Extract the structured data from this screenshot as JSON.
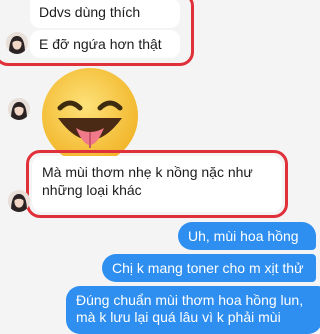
{
  "messages": {
    "m1": [
      "Ddvs dùng thích",
      "E đỡ ngứa hơn thật"
    ],
    "m2_emoji": "haha-tongue-emoji",
    "m3": [
      "Mà mùi thơm nhẹ k nồng nặc như",
      "những loại khác"
    ],
    "m4": "Uh, mùi hoa hồng",
    "m5": "Chị k mang toner cho m xịt thử",
    "m6": [
      "Đúng chuẩn mùi thơm hoa hồng lun,",
      "mà k lưu lại quá lâu vì k phải mùi"
    ]
  },
  "colors": {
    "incoming_bg": "#ffffff",
    "outgoing_bg": "#2e8ff0",
    "highlight": "#e0303a",
    "emoji_yellow": "#f7c53a"
  }
}
